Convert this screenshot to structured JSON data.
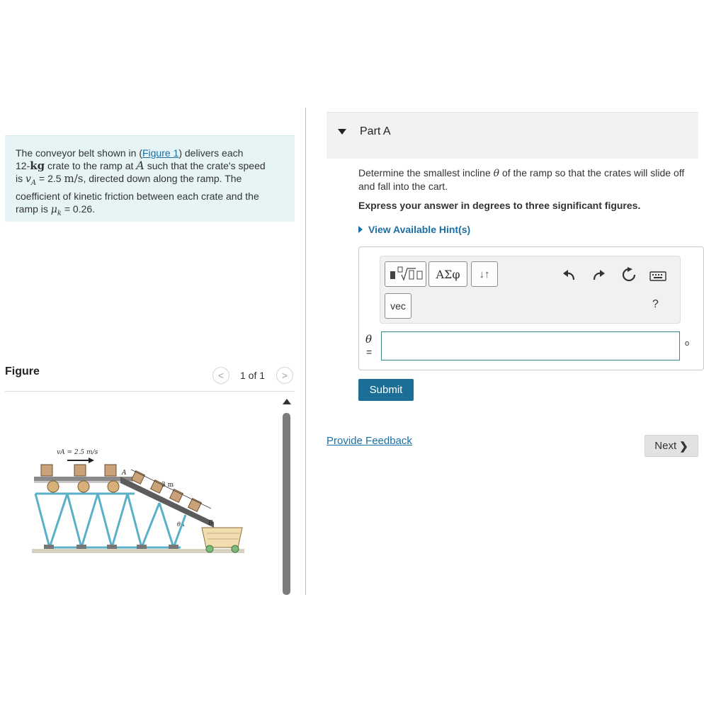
{
  "problem": {
    "text_1": "The conveyor belt shown in (",
    "figure_link": "Figure 1",
    "text_2": ") delivers each",
    "mass": "12-",
    "mass_unit": "kg",
    "text_3": " crate to the ramp at ",
    "point": "A",
    "text_4": " such that the crate's speed",
    "text_5": "is ",
    "speed_var": "v",
    "speed_sub": "A",
    "speed_val": " = 2.5 ",
    "speed_unit": "m/s",
    "text_6": ", directed down along the ramp. The",
    "text_7": "coefficient of kinetic friction between each crate and the",
    "text_8": "ramp is ",
    "mu": "μ",
    "mu_sub": "k",
    "mu_val": " = 0.26."
  },
  "figure": {
    "title": "Figure",
    "count": "1 of 1",
    "prev_icon": "chevron-left-icon",
    "next_icon": "chevron-right-icon",
    "labels": {
      "speed": "vA = 2.5 m/s",
      "point_a": "A",
      "length": "3 m",
      "angle": "θA",
      "point_b": "B"
    }
  },
  "part": {
    "label": "Part A",
    "question_1": "Determine the smallest incline ",
    "theta": "θ",
    "question_2": " of the ramp so that the crates will slide off and fall into the cart.",
    "instruction": "Express your answer in degrees to three significant figures.",
    "hint": "View Available Hint(s)"
  },
  "toolbar": {
    "templates_icon": "templates-icon",
    "greek": "ΑΣφ",
    "arrows": "↓↑",
    "vec": "vec",
    "help": "?",
    "icons": [
      "undo-icon",
      "redo-icon",
      "reset-icon",
      "keyboard-icon"
    ]
  },
  "answer": {
    "var": "θ",
    "eq": "=",
    "value": "",
    "unit": "o"
  },
  "actions": {
    "submit": "Submit",
    "feedback": "Provide Feedback",
    "next": "Next"
  },
  "colors": {
    "accent": "#1b6f96",
    "link": "#1a6fa3",
    "problem_bg": "#e6f4f6",
    "input_border": "#3a8a86",
    "truss": "#5ab0c8"
  }
}
